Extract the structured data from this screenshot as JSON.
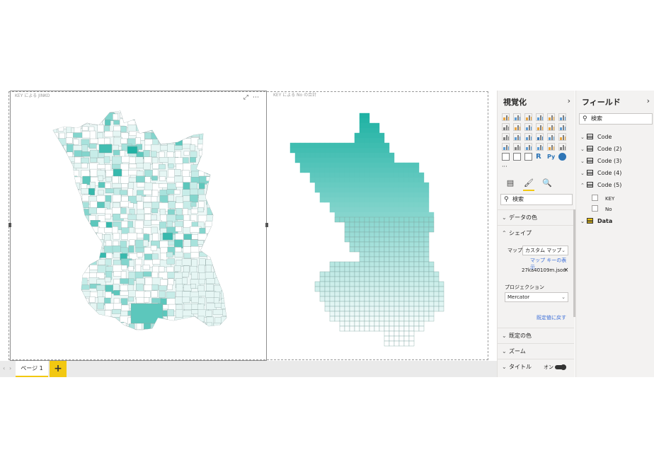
{
  "visuals": [
    {
      "title": "KEY による JINKO"
    },
    {
      "title": "KEY による No の合計"
    }
  ],
  "pages": {
    "tabs": [
      "ページ 1"
    ],
    "add_label": "+"
  },
  "visualizations_pane": {
    "title": "視覚化",
    "search_placeholder": "検索",
    "sections": {
      "data_colors": "データの色",
      "shape": "シェイプ",
      "default_colors": "既定の色",
      "zoom": "ズーム",
      "title": "タイトル"
    },
    "map_label": "マップ",
    "map_value": "カスタム マップ",
    "view_map_keys": "マップ キーの表示…",
    "map_file": "27ka40109m.json",
    "projection_label": "プロジェクション",
    "projection_value": "Mercator",
    "revert_default": "既定値に戻す",
    "title_toggle": "オン"
  },
  "fields_pane": {
    "title": "フィールド",
    "search_placeholder": "検索",
    "tables": [
      "Code",
      "Code (2)",
      "Code (3)",
      "Code (4)",
      "Code (5)"
    ],
    "code5_fields": [
      "KEY",
      "No"
    ],
    "data_table": "Data"
  },
  "colors": {
    "accent": "#f2c811",
    "map_teal": "#20b2a4",
    "map_light": "#e6f6f4"
  }
}
